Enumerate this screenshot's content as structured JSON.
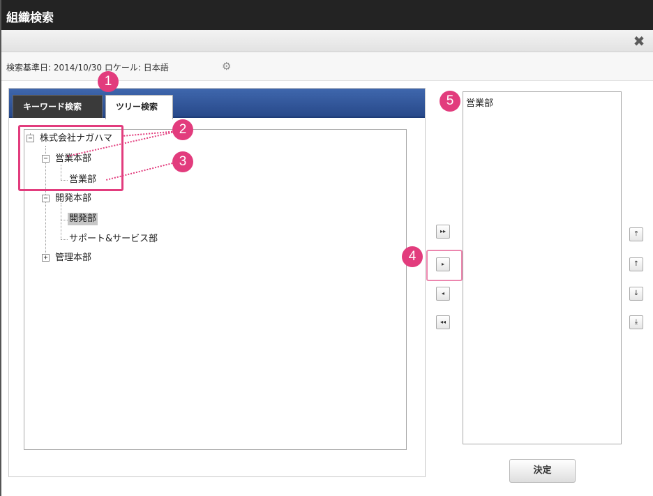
{
  "dialog": {
    "title": "組織検索",
    "close_icon": "close-icon",
    "info_text": "検索基準日: 2014/10/30 ロケール: 日本語",
    "gear_icon": "gear-icon"
  },
  "tabs": {
    "keyword_label": "キーワード検索",
    "tree_label": "ツリー検索",
    "active": "ツリー検索"
  },
  "tree": {
    "root": "株式会社ナガハマ",
    "sales_hq": "営業本部",
    "sales_dept": "営業部",
    "dev_hq": "開発本部",
    "dev_dept": "開発部",
    "support_dept": "サポート&サービス部",
    "mgmt_hq": "管理本部",
    "expanded_symbol": "−",
    "collapsed_symbol": "+"
  },
  "mid_buttons": {
    "add_all": "▸▸",
    "add": "▸",
    "remove": "◂",
    "remove_all": "◂◂"
  },
  "order_buttons": {
    "top": "⤒",
    "up": "↑",
    "down": "↓",
    "bottom": "⤓"
  },
  "selected": {
    "items": [
      "営業部"
    ]
  },
  "footer": {
    "decide_label": "決定"
  },
  "callouts": {
    "c1": "1",
    "c2": "2",
    "c3": "3",
    "c4": "4",
    "c5": "5"
  },
  "colors": {
    "accent": "#e23c7d",
    "tabbar": "#2f5296",
    "titlebar": "#232323"
  }
}
